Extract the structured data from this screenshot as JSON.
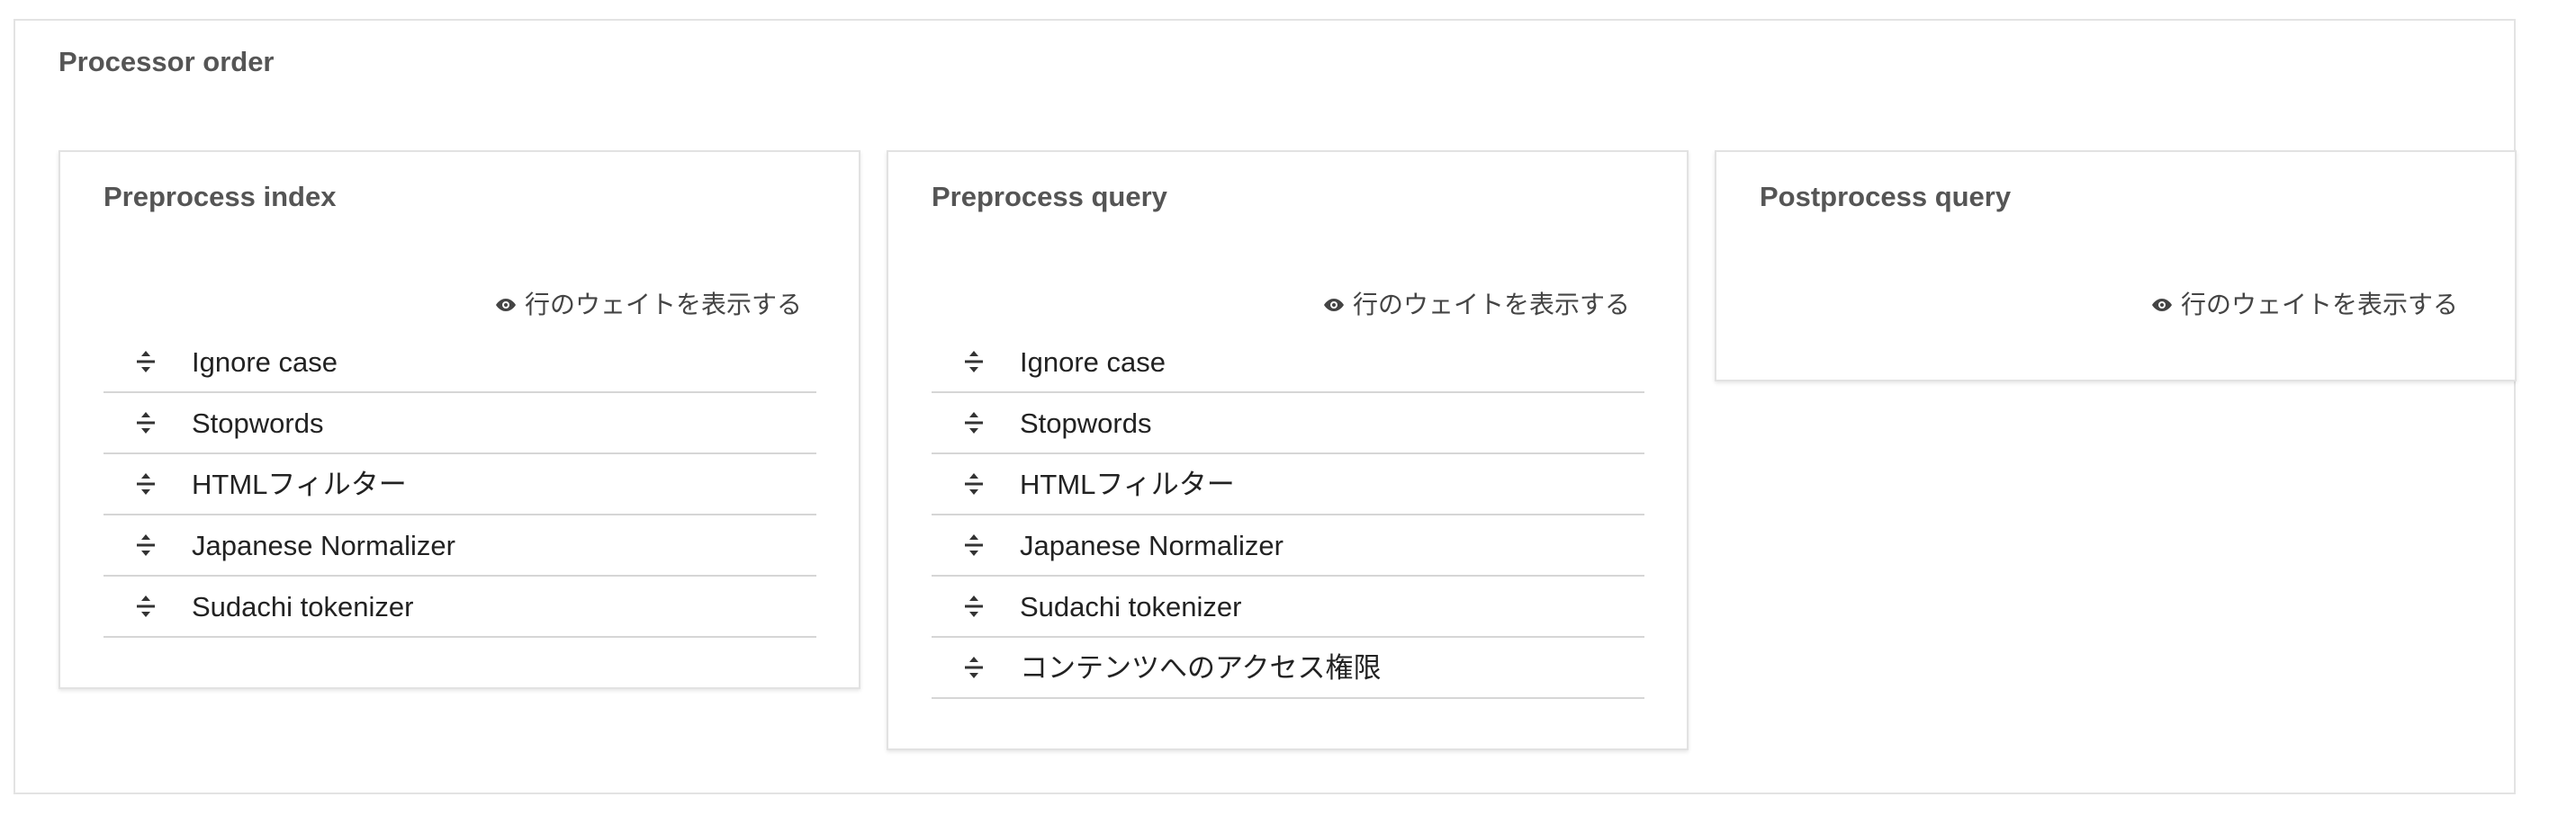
{
  "section": {
    "title": "Processor order"
  },
  "columns": [
    {
      "title": "Preprocess index",
      "weight_toggle_label": "行のウェイトを表示する",
      "items": [
        {
          "label": "Ignore case"
        },
        {
          "label": "Stopwords"
        },
        {
          "label": "HTMLフィルター"
        },
        {
          "label": "Japanese Normalizer"
        },
        {
          "label": "Sudachi tokenizer"
        }
      ]
    },
    {
      "title": "Preprocess query",
      "weight_toggle_label": "行のウェイトを表示する",
      "items": [
        {
          "label": "Ignore case"
        },
        {
          "label": "Stopwords"
        },
        {
          "label": "HTMLフィルター"
        },
        {
          "label": "Japanese Normalizer"
        },
        {
          "label": "Sudachi tokenizer"
        },
        {
          "label": "コンテンツへのアクセス権限"
        }
      ]
    },
    {
      "title": "Postprocess query",
      "weight_toggle_label": "行のウェイトを表示する",
      "items": []
    }
  ],
  "icons": {
    "weight_toggle": "eye-icon",
    "drag_handle": "drag-handle-icon"
  },
  "colors": {
    "heading": "#555555",
    "text": "#222222",
    "border": "#e2e2e2",
    "row_divider": "#d6d6d6"
  }
}
